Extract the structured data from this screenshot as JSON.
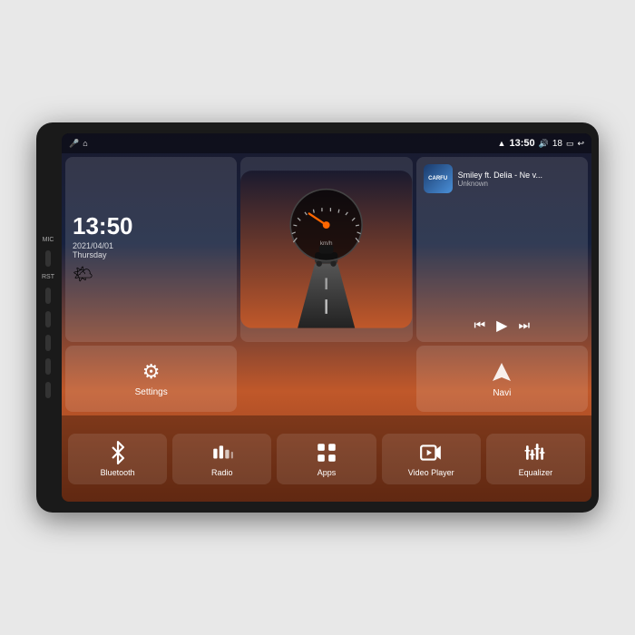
{
  "device": {
    "side_labels": [
      "MIC",
      "RST"
    ]
  },
  "status_bar": {
    "mic": "MIC",
    "time": "13:50",
    "volume": "18",
    "signal_icon": "wifi",
    "battery_icon": "battery"
  },
  "clock": {
    "time": "13:50",
    "date": "2021/04/01",
    "day": "Thursday",
    "weather_icon": "🌤"
  },
  "music": {
    "logo_text": "CARFU",
    "title": "Smiley ft. Delia - Ne v...",
    "artist": "Unknown"
  },
  "settings_btn": {
    "label": "Settings",
    "icon": "⚙"
  },
  "navi_btn": {
    "label": "Navi",
    "icon": "🧭"
  },
  "apps": [
    {
      "id": "bluetooth",
      "label": "Bluetooth",
      "icon": "bluetooth"
    },
    {
      "id": "radio",
      "label": "Radio",
      "icon": "radio"
    },
    {
      "id": "apps",
      "label": "Apps",
      "icon": "apps"
    },
    {
      "id": "video-player",
      "label": "Video Player",
      "icon": "video"
    },
    {
      "id": "equalizer",
      "label": "Equalizer",
      "icon": "equalizer"
    }
  ]
}
